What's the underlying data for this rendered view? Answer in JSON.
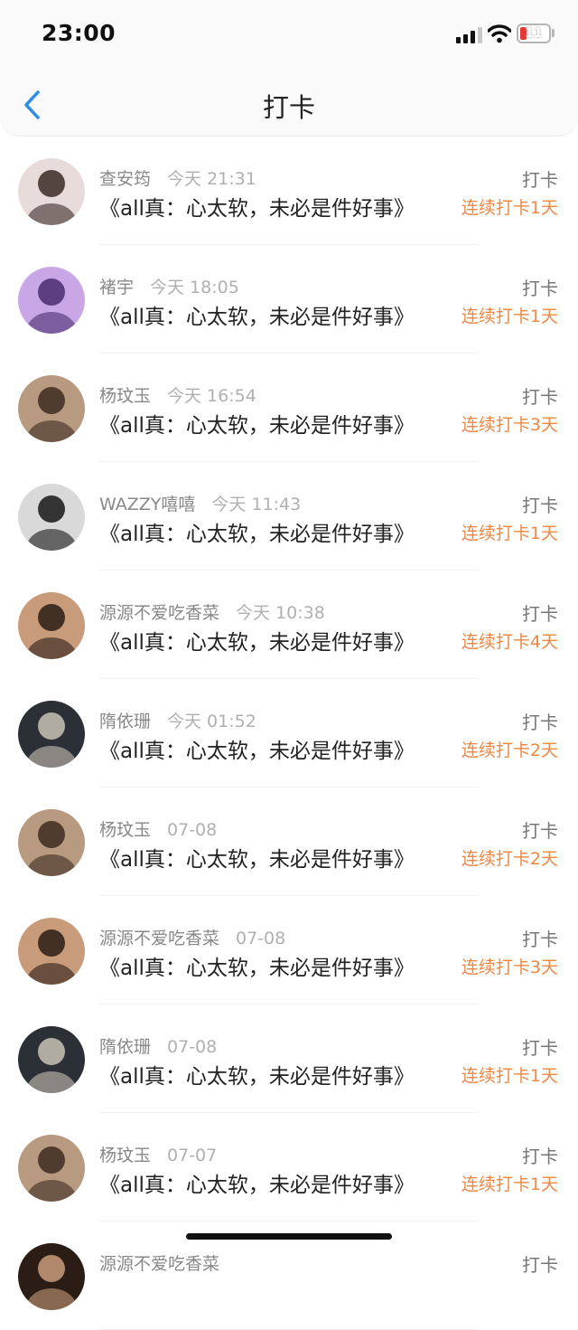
{
  "status_bar": {
    "time": "23:00",
    "battery": "11"
  },
  "nav": {
    "title": "打卡"
  },
  "entries": [
    {
      "name": "查安筠",
      "time": "今天 21:31",
      "title": "《all真：心太软，未必是件好事》",
      "action": "打卡",
      "streak": "连续打卡1天",
      "avatar": {
        "bg": "#e7dcd9",
        "fg": "#3a2a26"
      }
    },
    {
      "name": "褚宇",
      "time": "今天 18:05",
      "title": "《all真：心太软，未必是件好事》",
      "action": "打卡",
      "streak": "连续打卡1天",
      "avatar": {
        "bg": "#c9a7e6",
        "fg": "#4a2d6e"
      }
    },
    {
      "name": "杨玟玉",
      "time": "今天 16:54",
      "title": "《all真：心太软，未必是件好事》",
      "action": "打卡",
      "streak": "连续打卡3天",
      "avatar": {
        "bg": "#b79a7f",
        "fg": "#3d2c20"
      }
    },
    {
      "name": "WAZZY嘻嘻",
      "time": "今天 11:43",
      "title": "《all真：心太软，未必是件好事》",
      "action": "打卡",
      "streak": "连续打卡1天",
      "avatar": {
        "bg": "#d9d9d9",
        "fg": "#151515"
      }
    },
    {
      "name": "源源不爱吃香菜",
      "time": "今天 10:38",
      "title": "《all真：心太软，未必是件好事》",
      "action": "打卡",
      "streak": "连续打卡4天",
      "avatar": {
        "bg": "#c89b7a",
        "fg": "#2b1d16"
      }
    },
    {
      "name": "隋依珊",
      "time": "今天 01:52",
      "title": "《all真：心太软，未必是件好事》",
      "action": "打卡",
      "streak": "连续打卡2天",
      "avatar": {
        "bg": "#2b2f36",
        "fg": "#c9c2b5"
      }
    },
    {
      "name": "杨玟玉",
      "time": "07-08",
      "title": "《all真：心太软，未必是件好事》",
      "action": "打卡",
      "streak": "连续打卡2天",
      "avatar": {
        "bg": "#b79a7f",
        "fg": "#3d2c20"
      }
    },
    {
      "name": "源源不爱吃香菜",
      "time": "07-08",
      "title": "《all真：心太软，未必是件好事》",
      "action": "打卡",
      "streak": "连续打卡3天",
      "avatar": {
        "bg": "#c89b7a",
        "fg": "#2b1d16"
      }
    },
    {
      "name": "隋依珊",
      "time": "07-08",
      "title": "《all真：心太软，未必是件好事》",
      "action": "打卡",
      "streak": "连续打卡1天",
      "avatar": {
        "bg": "#2b2f36",
        "fg": "#c9c2b5"
      }
    },
    {
      "name": "杨玟玉",
      "time": "07-07",
      "title": "《all真：心太软，未必是件好事》",
      "action": "打卡",
      "streak": "连续打卡1天",
      "avatar": {
        "bg": "#b79a7f",
        "fg": "#3d2c20"
      }
    },
    {
      "name": "源源不爱吃香菜",
      "time": "",
      "title": "",
      "action": "打卡",
      "streak": "",
      "avatar": {
        "bg": "#2b1d16",
        "fg": "#c89b7a"
      }
    }
  ],
  "colors": {
    "accent": "#2f8fe3",
    "streak": "#f08845"
  },
  "icons": {
    "back": "chevron-left-icon"
  }
}
